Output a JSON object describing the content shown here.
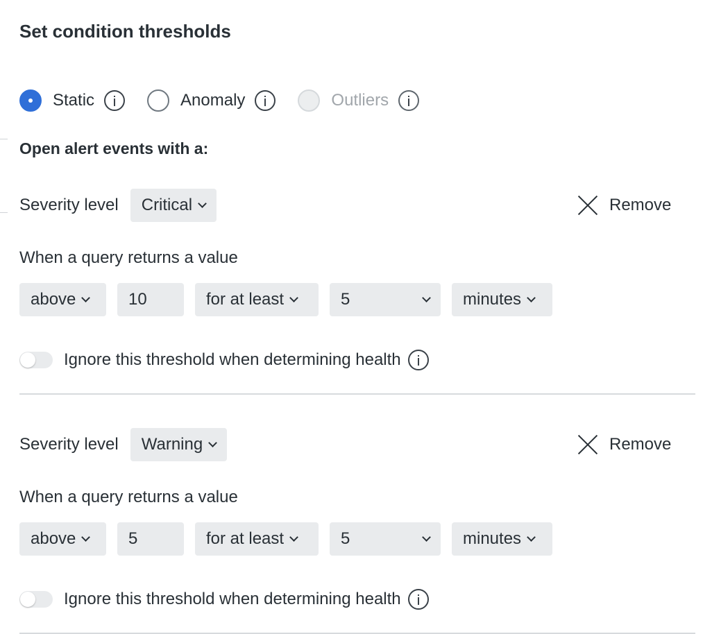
{
  "title": "Set condition thresholds",
  "threshold_types": [
    {
      "label": "Static",
      "state": "checked",
      "info_icon": "info-icon"
    },
    {
      "label": "Anomaly",
      "state": "unchecked",
      "info_icon": "info-icon"
    },
    {
      "label": "Outliers",
      "state": "disabled",
      "info_icon": "info-icon"
    }
  ],
  "open_events_label": "Open alert events with a:",
  "thresholds": [
    {
      "severity_label": "Severity level",
      "severity_value": "Critical",
      "remove_label": "Remove",
      "query_label": "When a query returns a value",
      "operator": "above",
      "value": "10",
      "duration_mode": "for at least",
      "duration_value": "5",
      "duration_unit": "minutes",
      "toggle_label": "Ignore this threshold when determining health",
      "toggle_on": false
    },
    {
      "severity_label": "Severity level",
      "severity_value": "Warning",
      "remove_label": "Remove",
      "query_label": "When a query returns a value",
      "operator": "above",
      "value": "5",
      "duration_mode": "for at least",
      "duration_value": "5",
      "duration_unit": "minutes",
      "toggle_label": "Ignore this threshold when determining health",
      "toggle_on": false
    }
  ],
  "colors": {
    "accent": "#2f6fd8",
    "text": "#293036",
    "control_bg": "#e9ebed",
    "muted_text": "#a1a6ab"
  }
}
